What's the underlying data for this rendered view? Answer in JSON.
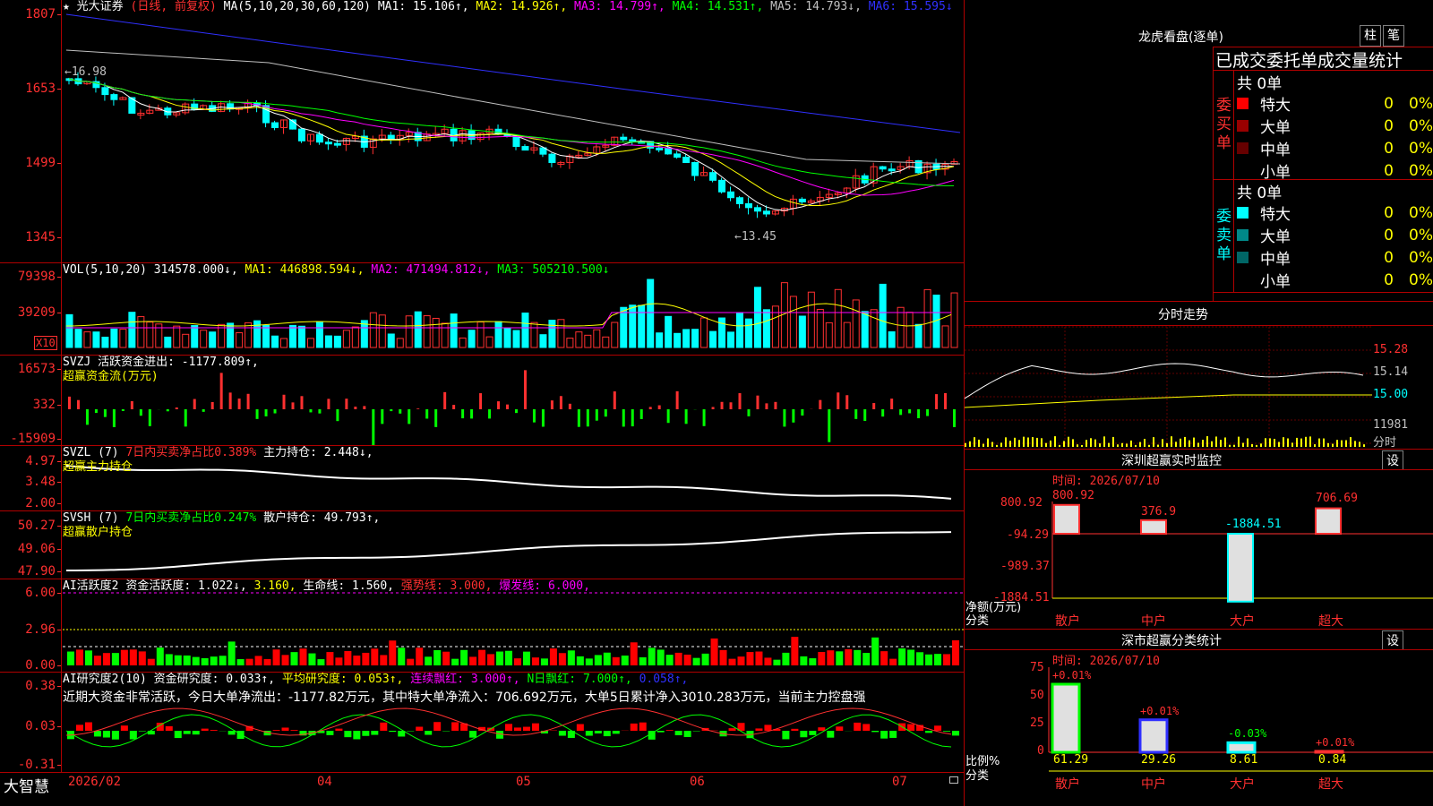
{
  "chart_header": {
    "star": "★",
    "stock": "光大证券",
    "mode": "(日线, 前复权)",
    "ma_label": "MA(5,10,20,30,60,120)",
    "ma1": "MA1: 15.106↑,",
    "ma2": "MA2: 14.926↑,",
    "ma3": "MA3: 14.799↑,",
    "ma4": "MA4: 14.531↑,",
    "ma5": "MA5: 14.793↓,",
    "ma6": "MA6: 15.595↓",
    "high_mark": "←16.98",
    "low_mark": "←13.45",
    "colors": {
      "ma1": "#ffffff",
      "ma2": "#ffff00",
      "ma3": "#ff00ff",
      "ma4": "#00ff00",
      "ma5": "#c0c0c0",
      "ma6": "#3030ff",
      "up": "#ff3030",
      "down": "#00ffff"
    }
  },
  "price_axis": [
    "1807",
    "1653",
    "1499",
    "1345"
  ],
  "vol": {
    "label": "VOL(5,10,20)",
    "value": "314578.000↓,",
    "ma1": "MA1: 446898.594↓,",
    "ma2": "MA2: 471494.812↓,",
    "ma3": "MA3: 505210.500↓",
    "axis": [
      "79398",
      "39209"
    ],
    "unit": "X10"
  },
  "svzj": {
    "label": "SVZJ  活跃资金进出: -1177.809↑,",
    "sub": "超赢资金流(万元)",
    "axis": [
      "16573",
      "332",
      "-15909"
    ]
  },
  "svzl": {
    "label": "SVZL (7)",
    "ratio": "7日内买卖净占比0.389%",
    "hold": "主力持仓: 2.448↓,",
    "sub": "超赢主力持仓",
    "axis": [
      "4.97",
      "3.48",
      "2.00"
    ]
  },
  "svsh": {
    "label": "SVSH (7)",
    "ratio": "7日内买卖净占比0.247%",
    "hold": "散户持仓: 49.793↑,",
    "sub": "超赢散户持仓",
    "axis": [
      "50.27",
      "49.06",
      "47.90"
    ]
  },
  "ai1": {
    "label": "AI活跃度2",
    "a": "资金活跃度: 1.022↓,",
    "b": "3.160,",
    "c": "生命线: 1.560,",
    "d": "强势线: 3.000,",
    "e": "爆发线: 6.000,",
    "axis": [
      "6.00",
      "2.96",
      "0.00"
    ]
  },
  "ai2": {
    "label": "AI研究度2(10)",
    "a": "资金研究度: 0.033↑,",
    "b": "平均研究度: 0.053↑,",
    "c": "连续飘红: 3.000↑,",
    "d": "N日飘红: 7.000↑,",
    "e": "0.058↑,",
    "summary": "近期大资金非常活跃，今日大单净流出：-1177.82万元，其中特大单净流入：706.692万元，大单5日累计净入3010.283万元，当前主力控盘强",
    "axis": [
      "0.38",
      "0.03",
      "-0.31"
    ]
  },
  "bottom": {
    "brand": "大智慧",
    "dates": [
      "2026/02",
      "04",
      "05",
      "06",
      "07"
    ]
  },
  "dragon": {
    "title": "龙虎看盘(逐单)",
    "btn_bar": "柱",
    "btn_pen": "笔",
    "header": "已成交委托单成交量统计",
    "buy_side": "委买单",
    "sell_side": "委卖单",
    "buy_total": "共 0单",
    "sell_total": "共 0单",
    "buy_rows": [
      {
        "name": "特大",
        "count": "0",
        "pct": "0%",
        "color": "#ff0000"
      },
      {
        "name": "大单",
        "count": "0",
        "pct": "0%",
        "color": "#990000"
      },
      {
        "name": "中单",
        "count": "0",
        "pct": "0%",
        "color": "#660000"
      },
      {
        "name": "小单",
        "count": "0",
        "pct": "0%",
        "color": ""
      }
    ],
    "sell_rows": [
      {
        "name": "特大",
        "count": "0",
        "pct": "0%",
        "color": "#00ffff"
      },
      {
        "name": "大单",
        "count": "0",
        "pct": "0%",
        "color": "#008888"
      },
      {
        "name": "中单",
        "count": "0",
        "pct": "0%",
        "color": "#006666"
      },
      {
        "name": "小单",
        "count": "0",
        "pct": "0%",
        "color": ""
      }
    ]
  },
  "intraday": {
    "title": "分时走势",
    "axis": [
      "15.28",
      "15.14",
      "15.00"
    ],
    "vol": "11981",
    "vol_label": "分时"
  },
  "sz_monitor": {
    "title": "深圳超赢实时监控",
    "btn": "设",
    "date": "时间: 2026/07/10",
    "axis": [
      "800.92",
      "-94.29",
      "-989.37",
      "-1884.51"
    ],
    "ylabel": "净额(万元)",
    "xlabel": "分类",
    "bars": [
      {
        "cat": "散户",
        "value": 800.92,
        "label": "800.92"
      },
      {
        "cat": "中户",
        "value": 376.9,
        "label": "376.9"
      },
      {
        "cat": "大户",
        "value": -1884.51,
        "label": "-1884.51"
      },
      {
        "cat": "超大",
        "value": 706.69,
        "label": "706.69"
      }
    ]
  },
  "sz_class": {
    "title": "深市超赢分类统计",
    "btn": "设",
    "date": "时间: 2026/07/10",
    "axis": [
      "75",
      "50",
      "25",
      "0"
    ],
    "ylabel": "比例%",
    "xlabel": "分类",
    "bars": [
      {
        "cat": "散户",
        "value": 61.29,
        "label": "61.29",
        "chg": "+0.01%"
      },
      {
        "cat": "中户",
        "value": 29.26,
        "label": "29.26",
        "chg": "+0.01%"
      },
      {
        "cat": "大户",
        "value": 8.61,
        "label": "8.61",
        "chg": "-0.03%"
      },
      {
        "cat": "超大",
        "value": 0.84,
        "label": "0.84",
        "chg": "+0.01%"
      }
    ]
  }
}
